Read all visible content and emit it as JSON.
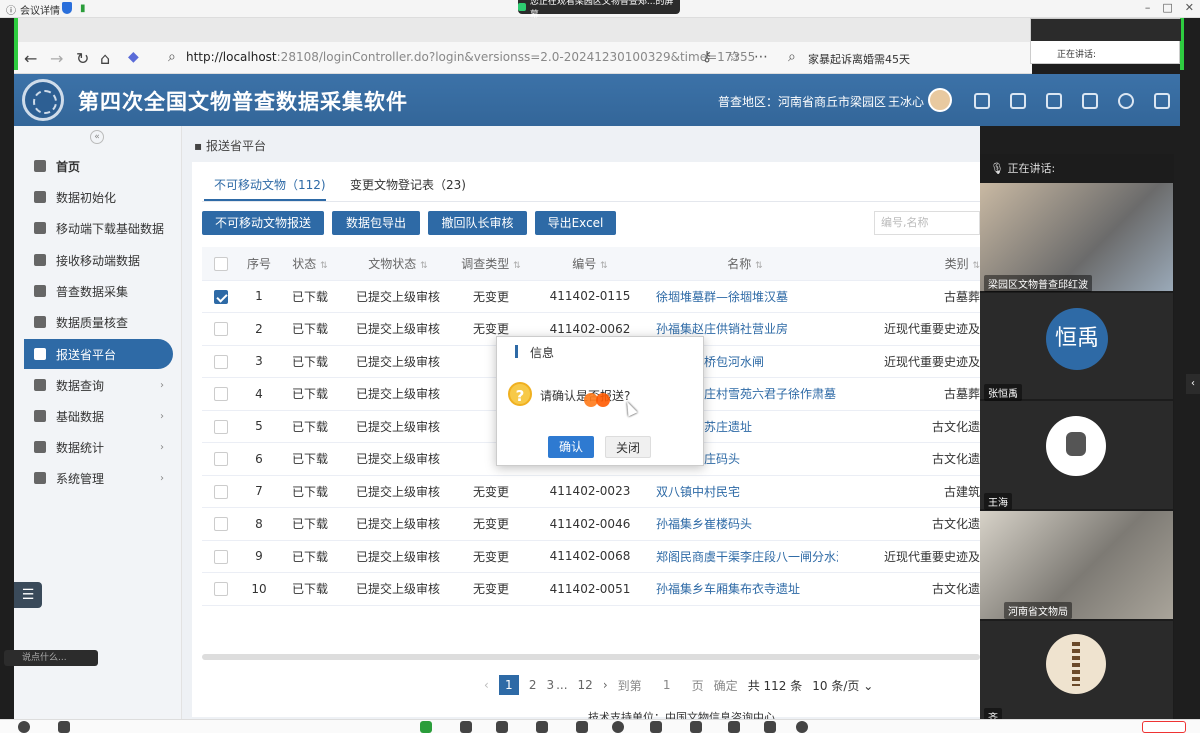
{
  "meeting": {
    "info_label": "会议详情",
    "share_banner": "您正在观看梁园区文物普查郑...的屏幕",
    "talking_label": "正在讲话:",
    "speaking_label": "正在讲话:",
    "participants": [
      {
        "name": "梁园区文物普查邱红波"
      },
      {
        "name": "张恒禹",
        "avatar_text": "恒禹"
      },
      {
        "name": "王海"
      },
      {
        "name": "河南省文物局"
      },
      {
        "name": "齐"
      }
    ],
    "chat_placeholder": "说点什么..."
  },
  "browser": {
    "url_host": "http://localhost",
    "url_rest": ":28108/loginController.do?login&versionss=2.0-20241230100329&time=17355",
    "search_text": "家暴起诉离婚需45天"
  },
  "app": {
    "title": "第四次全国文物普查数据采集软件",
    "region": "普查地区：河南省商丘市梁园区",
    "user": "王冰心"
  },
  "sidebar": {
    "items": [
      {
        "label": "首页",
        "icon": "home-icon"
      },
      {
        "label": "数据初始化",
        "icon": "init-icon"
      },
      {
        "label": "移动端下载基础数据",
        "icon": "download-icon"
      },
      {
        "label": "接收移动端数据",
        "icon": "receive-icon"
      },
      {
        "label": "普查数据采集",
        "icon": "collect-icon"
      },
      {
        "label": "数据质量核查",
        "icon": "check-icon"
      },
      {
        "label": "报送省平台",
        "icon": "submit-icon"
      },
      {
        "label": "数据查询",
        "icon": "query-icon"
      },
      {
        "label": "基础数据",
        "icon": "base-icon"
      },
      {
        "label": "数据统计",
        "icon": "stats-icon"
      },
      {
        "label": "系统管理",
        "icon": "system-icon"
      }
    ]
  },
  "main": {
    "breadcrumb": "报送省平台",
    "tabs": [
      {
        "label": "不可移动文物（112)"
      },
      {
        "label": "变更文物登记表（23)"
      }
    ],
    "buttons": [
      "不可移动文物报送",
      "数据包导出",
      "撤回队长审核",
      "导出Excel"
    ],
    "search_placeholder": "编号,名称",
    "columns": [
      "序号",
      "状态",
      "文物状态",
      "调查类型",
      "编号",
      "名称",
      "类别"
    ],
    "rows": [
      {
        "no": "1",
        "status": "已下载",
        "relic_status": "已提交上级审核",
        "survey": "无变更",
        "code": "411402-0115",
        "name": "徐堌堆墓群—徐堌堆汉墓",
        "category": "古墓葬",
        "checked": true
      },
      {
        "no": "2",
        "status": "已下载",
        "relic_status": "已提交上级审核",
        "survey": "无变更",
        "code": "411402-0062",
        "name": "孙福集赵庄供销社营业房",
        "category": "近现代重要史迹及"
      },
      {
        "no": "3",
        "status": "已下载",
        "relic_status": "已提交上级审核",
        "survey": "",
        "code": "",
        "name": "海街道金桥包河水闸",
        "category": "近现代重要史迹及"
      },
      {
        "no": "4",
        "status": "已下载",
        "relic_status": "已提交上级审核",
        "survey": "",
        "code": "",
        "name": "池铺镇徐庄村雪苑六君子徐作肃墓",
        "category": "古墓葬"
      },
      {
        "no": "5",
        "status": "已下载",
        "relic_status": "已提交上级审核",
        "survey": "",
        "code": "",
        "name": "平原街道苏庄遗址",
        "category": "古文化遗"
      },
      {
        "no": "6",
        "status": "已下载",
        "relic_status": "已提交上级审核",
        "survey": "",
        "code": "",
        "name": "福集乡胡庄码头",
        "category": "古文化遗"
      },
      {
        "no": "7",
        "status": "已下载",
        "relic_status": "已提交上级审核",
        "survey": "无变更",
        "code": "411402-0023",
        "name": "双八镇中村民宅",
        "category": "古建筑"
      },
      {
        "no": "8",
        "status": "已下载",
        "relic_status": "已提交上级审核",
        "survey": "无变更",
        "code": "411402-0046",
        "name": "孙福集乡崔楼码头",
        "category": "古文化遗"
      },
      {
        "no": "9",
        "status": "已下载",
        "relic_status": "已提交上级审核",
        "survey": "无变更",
        "code": "411402-0068",
        "name": "郑阁民商虞干渠李庄段八一闸分水涵",
        "category": "近现代重要史迹及"
      },
      {
        "no": "10",
        "status": "已下载",
        "relic_status": "已提交上级审核",
        "survey": "无变更",
        "code": "411402-0051",
        "name": "孙福集乡车厢集布衣寺遗址",
        "category": "古文化遗"
      }
    ],
    "pager": {
      "pages": [
        "1",
        "2",
        "3",
        "...",
        "12"
      ],
      "goto_label": "到第",
      "goto_value": "1",
      "page_unit": "页",
      "confirm": "确定",
      "total": "共 112 条",
      "page_size": "10 条/页"
    },
    "footer": "技术支持单位：中国文物信息咨询中心"
  },
  "dialog": {
    "title": "信息",
    "message": "请确认是否报送?",
    "ok": "确认",
    "close": "关闭"
  },
  "colors": {
    "primary": "#2e6aa6",
    "header": "#336699",
    "accent_green": "#2ecc40"
  }
}
